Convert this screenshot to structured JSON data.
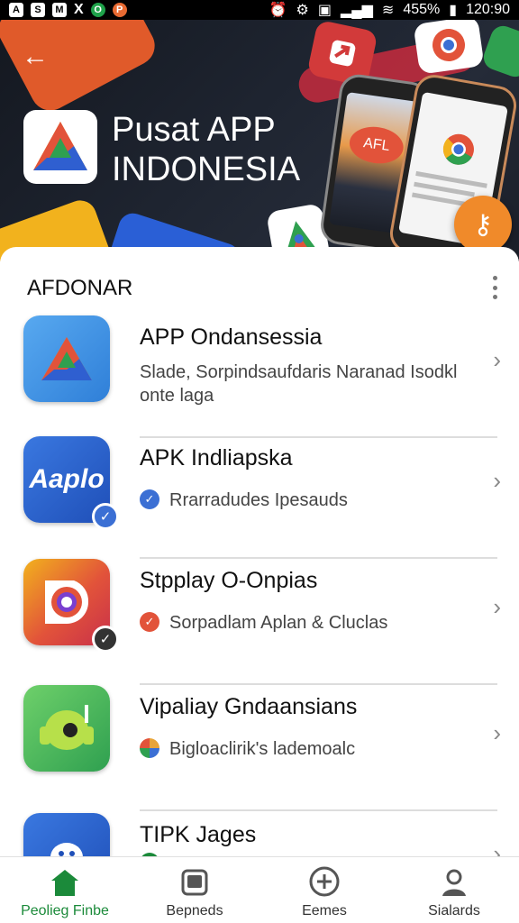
{
  "status_bar": {
    "left_icons": [
      "A",
      "S",
      "M",
      "X",
      "O",
      "P"
    ],
    "battery": "455%",
    "time": "120:90"
  },
  "header": {
    "back_icon": "arrow-left-icon",
    "title_line1": "Pusat APP",
    "title_line2": "INDONESIA",
    "phone_screen_text": "AFL",
    "fab_icon": "key-icon"
  },
  "section": {
    "title": "AFDONAR",
    "menu_icon": "more-vertical-icon"
  },
  "apps": [
    {
      "title": "APP Ondansessia",
      "subtitle": "Slade, Sorpindsaufdaris Naranad Isodkl onte laga",
      "icon": "triangle-logo-icon",
      "icon_text": "",
      "badge": "",
      "status_color": ""
    },
    {
      "title": "APK Indliapska",
      "subtitle": "Rrarradudes Ipesauds",
      "icon": "aaplo-logo-icon",
      "icon_text": "Aaplo",
      "badge": "check",
      "status_color": "#3b6fd4"
    },
    {
      "title": "Stpplay O-Onpias",
      "subtitle": "Sorpadlam Aplan & Cluclas",
      "icon": "camera-logo-icon",
      "icon_text": "",
      "badge": "check",
      "status_color": "#e2533a"
    },
    {
      "title": "Vipaliay Gndaansians",
      "subtitle": "Bigloaclirik's lademoalc",
      "icon": "android-logo-icon",
      "icon_text": "",
      "badge": "",
      "status_color": "#e9a43a"
    },
    {
      "title": "TIPK Jages",
      "subtitle": "",
      "icon": "android-blue-icon",
      "icon_text": "",
      "badge": "",
      "status_color": "#1b8a3a"
    }
  ],
  "bottom_nav": [
    {
      "label": "Peolieg Finbe",
      "icon": "home-icon",
      "active": true
    },
    {
      "label": "Bepneds",
      "icon": "tablet-icon",
      "active": false
    },
    {
      "label": "Eemes",
      "icon": "plus-circle-icon",
      "active": false
    },
    {
      "label": "Sialards",
      "icon": "person-icon",
      "active": false
    }
  ],
  "colors": {
    "accent_green": "#1b8a3a",
    "fab_orange": "#f08a2a",
    "banner_dark": "#1e2430"
  }
}
